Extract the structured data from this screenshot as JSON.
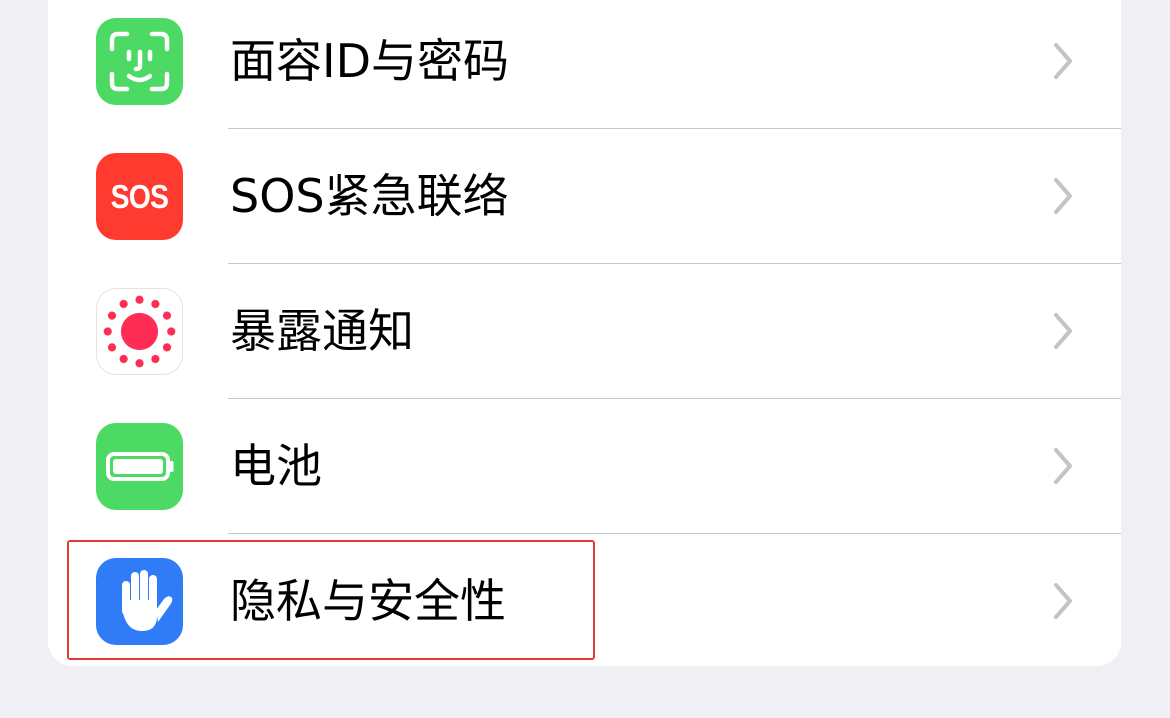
{
  "settings": {
    "items": [
      {
        "label": "面容ID与密码",
        "icon": "face-id-icon",
        "icon_color": "#4cd964"
      },
      {
        "label": "SOS紧急联络",
        "icon": "sos-icon",
        "icon_text": "SOS",
        "icon_color": "#ff3b30"
      },
      {
        "label": "暴露通知",
        "icon": "exposure-notification-icon",
        "icon_color": "#ffffff"
      },
      {
        "label": "电池",
        "icon": "battery-icon",
        "icon_color": "#4cd964"
      },
      {
        "label": "隐私与安全性",
        "icon": "privacy-hand-icon",
        "icon_color": "#2f7cf6"
      }
    ]
  },
  "highlight": {
    "target": "隐私与安全性",
    "color": "#e53935"
  }
}
